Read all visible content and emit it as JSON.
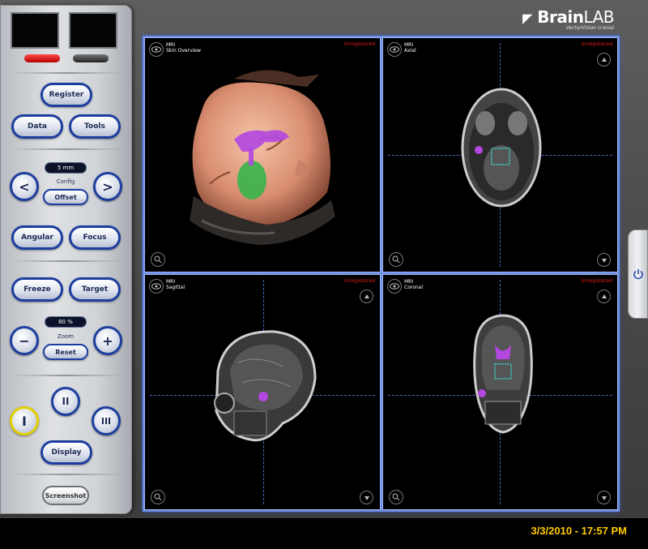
{
  "brand": {
    "name_prefix": "Brain",
    "name_suffix": "LAB",
    "subtitle": "VectorVision cranial"
  },
  "panel": {
    "register": "Register",
    "data": "Data",
    "tools": "Tools",
    "step_value": "5 mm",
    "step_label": "Config",
    "offset": "Offset",
    "angular": "Angular",
    "freeze": "Freeze",
    "zoom_value": "80 %",
    "zoom_label": "Zoom",
    "reset": "Reset",
    "screenshot": "Screenshot",
    "prev_symbol": "<",
    "next_symbol": ">",
    "minus_symbol": "−",
    "plus_symbol": "+",
    "view_I": "I",
    "view_II": "II",
    "view_III": "III",
    "display": "Display",
    "focus_label": "Focus",
    "target_label": "Target"
  },
  "viewports": [
    {
      "modality": "MRI",
      "name": "Skin Overview",
      "status": "Unregistered"
    },
    {
      "modality": "MRI",
      "name": "Axial",
      "status": "Unregistered"
    },
    {
      "modality": "MRI",
      "name": "Sagittal",
      "status": "Unregistered"
    },
    {
      "modality": "MRI",
      "name": "Coronal",
      "status": "Unregistered"
    }
  ],
  "clock": "3/3/2010 - 17:57 PM",
  "colors": {
    "accent_blue": "#1d3e9e",
    "status_red": "#e01a1a",
    "clock_yellow": "#ffcb05",
    "tumor_green": "#39b54a",
    "tumor_purple": "#b347e0"
  },
  "icons": {
    "eye": "eye-icon",
    "up": "up-arrow-icon",
    "zoom": "magnifier-icon",
    "down": "down-arrow-icon",
    "power": "power-icon",
    "brand": "brainlab-logo-icon"
  }
}
